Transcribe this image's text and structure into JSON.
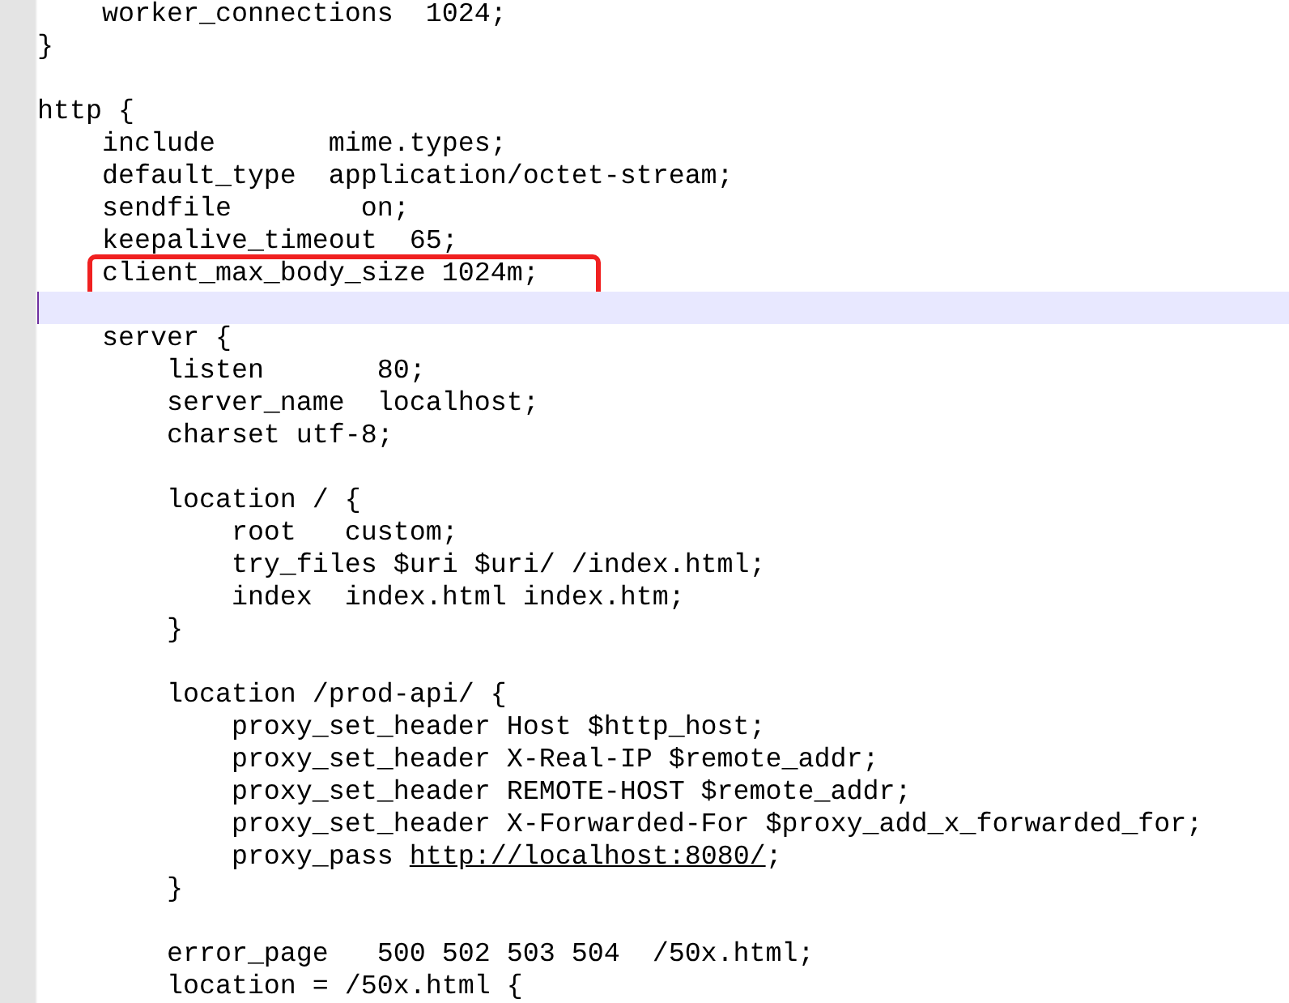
{
  "editor": {
    "lines": [
      {
        "text": "    worker_connections  1024;"
      },
      {
        "text": "}"
      },
      {
        "kind": "blank"
      },
      {
        "text": "http {"
      },
      {
        "text": "    include       mime.types;"
      },
      {
        "text": "    default_type  application/octet-stream;"
      },
      {
        "text": "    sendfile        on;"
      },
      {
        "text": "    keepalive_timeout  65;"
      },
      {
        "text": "    client_max_body_size 1024m;",
        "boxed": true
      },
      {
        "kind": "blank",
        "current": true
      },
      {
        "text": "    server {"
      },
      {
        "text": "        listen       80;"
      },
      {
        "text": "        server_name  localhost;"
      },
      {
        "text": "        charset utf-8;"
      },
      {
        "kind": "blank"
      },
      {
        "text": "        location / {"
      },
      {
        "text": "            root   custom;"
      },
      {
        "text": "            try_files $uri $uri/ /index.html;"
      },
      {
        "text": "            index  index.html index.htm;"
      },
      {
        "text": "        }"
      },
      {
        "kind": "blank"
      },
      {
        "text": "        location /prod-api/ {"
      },
      {
        "text": "            proxy_set_header Host $http_host;"
      },
      {
        "text": "            proxy_set_header X-Real-IP $remote_addr;"
      },
      {
        "text": "            proxy_set_header REMOTE-HOST $remote_addr;"
      },
      {
        "text": "            proxy_set_header X-Forwarded-For $proxy_add_x_forwarded_for;"
      },
      {
        "text": "            proxy_pass ",
        "link": "http://localhost:8080/",
        "after": ";"
      },
      {
        "text": "        }"
      },
      {
        "kind": "blank"
      },
      {
        "text": "        error_page   500 502 503 504  /50x.html;"
      },
      {
        "text": "        location = /50x.html {"
      }
    ]
  }
}
